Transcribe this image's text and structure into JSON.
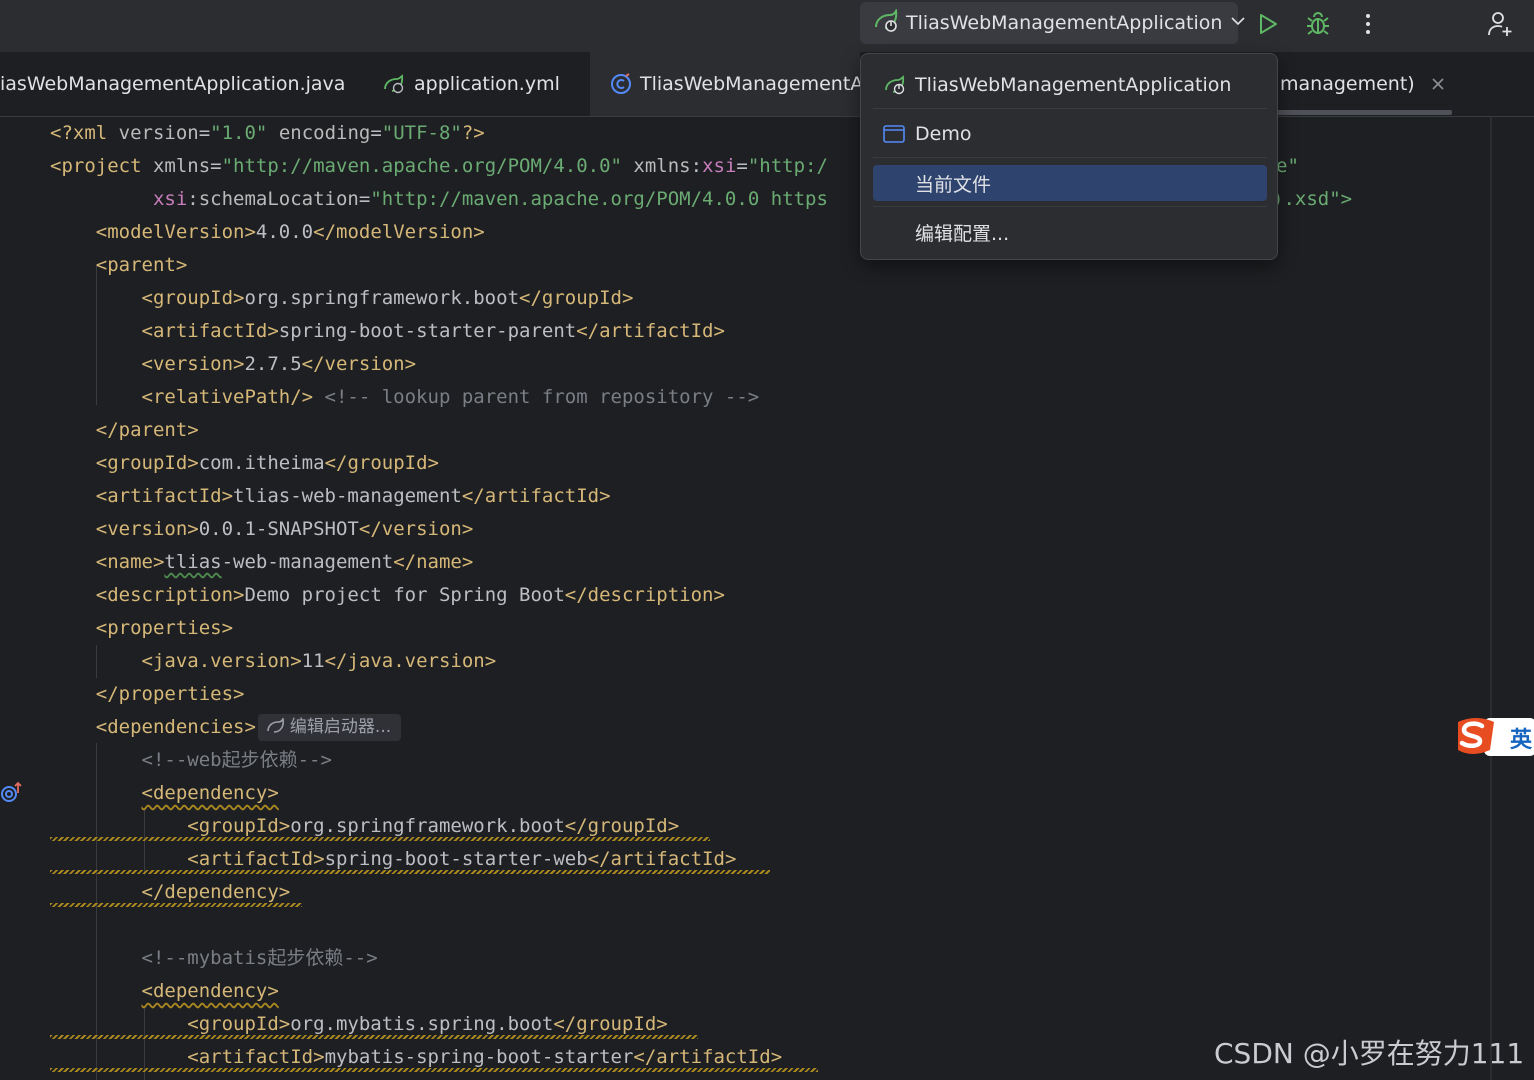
{
  "titlebar": {
    "run_config": "TliasWebManagementApplication",
    "icons": [
      "spring-boot-icon",
      "chevron-down-icon",
      "run-icon",
      "debug-icon",
      "more-vert-icon",
      "add-user-icon"
    ]
  },
  "tabs": [
    {
      "label": "iasWebManagementApplication.java"
    },
    {
      "label": "application.yml"
    },
    {
      "label": "TliasWebManagementAp"
    },
    {
      "label": "management)"
    }
  ],
  "dropdown": {
    "items": [
      {
        "label": "TliasWebManagementApplication",
        "icon": "spring-boot-icon"
      },
      {
        "label": "Demo",
        "icon": "application-window-icon"
      },
      {
        "label": "当前文件",
        "selected": true
      },
      {
        "label": "编辑配置..."
      }
    ]
  },
  "editor": {
    "inline_chip": "编辑启动器...",
    "lines": {
      "l1": {
        "p1": "<?xml ",
        "p2": "version",
        "p3": "=",
        "p4": "\"1.0\"",
        "p5": " encoding",
        "p6": "=",
        "p7": "\"UTF-8\"",
        "p8": "?>"
      },
      "l2": {
        "p1": "<project ",
        "p2": "xmlns",
        "p3": "=",
        "p4": "\"http://maven.apache.org/POM/4.0.0\"",
        "p5": " xmlns",
        "p6": ":",
        "p7": "xsi",
        "p8": "=",
        "p9": "\"http:/",
        "p10": "e\""
      },
      "l3": {
        "p1": "xsi",
        "p2": ":schemaLocation",
        "p3": "=",
        "p4": "\"http://maven.apache.org/POM/4.0.0 https",
        "p5": ").xsd\">"
      },
      "l4": {
        "p1": "<modelVersion>",
        "p2": "4.0.0",
        "p3": "</modelVersion>"
      },
      "l5": {
        "p1": "<parent>"
      },
      "l6": {
        "p1": "<groupId>",
        "p2": "org.springframework.boot",
        "p3": "</groupId>"
      },
      "l7": {
        "p1": "<artifactId>",
        "p2": "spring-boot-starter-parent",
        "p3": "</artifactId>"
      },
      "l8": {
        "p1": "<version>",
        "p2": "2.7.5",
        "p3": "</version>"
      },
      "l9": {
        "p1": "<relativePath/>",
        "p2": " <!-- lookup parent from repository -->"
      },
      "l10": {
        "p1": "</parent>"
      },
      "l11": {
        "p1": "<groupId>",
        "p2": "com.itheima",
        "p3": "</groupId>"
      },
      "l12": {
        "p1": "<artifactId>",
        "p2": "tlias-web-management",
        "p3": "</artifactId>"
      },
      "l13": {
        "p1": "<version>",
        "p2": "0.0.1-SNAPSHOT",
        "p3": "</version>"
      },
      "l14": {
        "p1": "<name>",
        "p2": "tlias",
        "p3": "-web-management",
        "p4": "</name>"
      },
      "l15": {
        "p1": "<description>",
        "p2": "Demo project for Spring Boot",
        "p3": "</description>"
      },
      "l16": {
        "p1": "<properties>"
      },
      "l17": {
        "p1": "<java.version>",
        "p2": "11",
        "p3": "</java.version>"
      },
      "l18": {
        "p1": "</properties>"
      },
      "l19": {
        "p1": "<dependencies>"
      },
      "l20": {
        "p1": "<!--web起步依赖-->"
      },
      "l21": {
        "p1": "<dependency>"
      },
      "l22": {
        "p1": "<groupId>",
        "p2": "org.springframework.boot",
        "p3": "</groupId>"
      },
      "l23": {
        "p1": "<artifactId>",
        "p2": "spring-boot-starter-web",
        "p3": "</artifactId>"
      },
      "l24": {
        "p1": "</dependency>"
      },
      "l26": {
        "p1": "<!--mybatis起步依赖-->"
      },
      "l27": {
        "p1": "<dependency>"
      },
      "l28": {
        "p1": "<groupId>",
        "p2": "org.mybatis.spring.boot",
        "p3": "</groupId>"
      },
      "l29": {
        "p1": "<artifactId>",
        "p2": "mybatis-spring-boot-starter",
        "p3": "</artifactId>"
      }
    }
  },
  "ime": {
    "label": "英",
    "icon": "sogou-s-icon"
  },
  "watermark": "CSDN @小罗在努力111",
  "colors": {
    "tag": "#d5b778",
    "string": "#6aab73",
    "namespace": "#c77dbb",
    "comment": "#7a7e85",
    "selection": "#2e436e",
    "run": "#5fb865"
  }
}
